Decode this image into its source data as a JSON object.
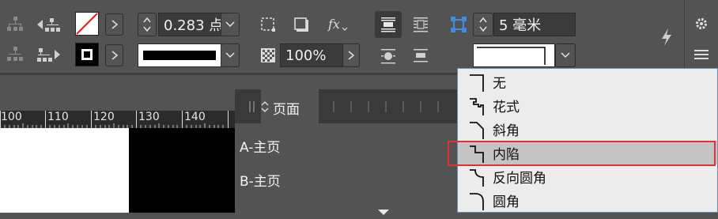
{
  "toolbar": {
    "stroke_weight": "0.283 点",
    "tint_percent": "100%",
    "corner_size": "5 毫米"
  },
  "ruler": {
    "ticks": [
      "100",
      "110",
      "120",
      "130",
      "140"
    ]
  },
  "pages_panel": {
    "tab_label": "页面",
    "masters": [
      "A-主页",
      "B-主页"
    ]
  },
  "corner_dropdown": {
    "options": [
      "无",
      "花式",
      "斜角",
      "内陷",
      "反向圆角",
      "圆角"
    ],
    "highlighted": "内陷"
  },
  "colors": {
    "ui_bg": "#535353",
    "dropdown_bg": "#ececec",
    "highlight_row": "#c4c4c4",
    "highlight_border": "#e03030"
  }
}
